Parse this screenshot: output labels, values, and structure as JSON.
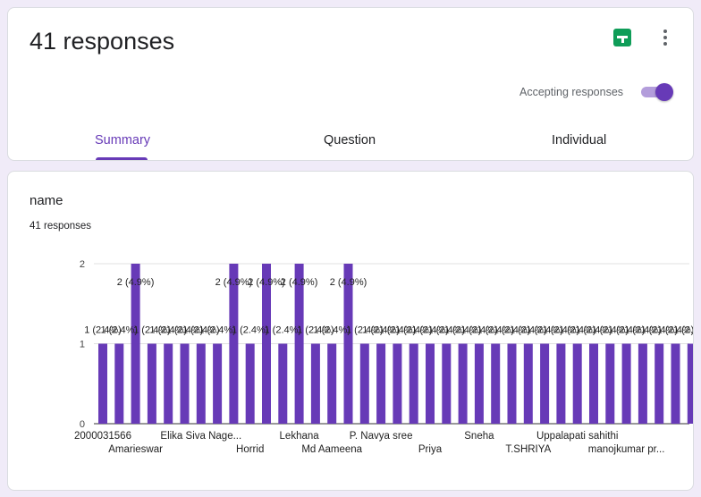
{
  "header": {
    "title": "41 responses",
    "accepting_label": "Accepting responses"
  },
  "icons": {
    "sheets": "google-sheets-icon",
    "more": "more-vert-icon"
  },
  "tabs": [
    {
      "label": "Summary",
      "active": true
    },
    {
      "label": "Question",
      "active": false
    },
    {
      "label": "Individual",
      "active": false
    }
  ],
  "question": {
    "title": "name",
    "response_count": "41 responses"
  },
  "colors": {
    "accent": "#673ab7",
    "bar": "#673ab7",
    "sheets": "#0f9d58"
  },
  "chart_data": {
    "type": "bar",
    "ylim": [
      0,
      2
    ],
    "y_ticks": [
      0,
      1,
      2
    ],
    "values": [
      1,
      1,
      2,
      1,
      1,
      1,
      1,
      1,
      2,
      1,
      2,
      1,
      2,
      1,
      1,
      2,
      1,
      1,
      1,
      1,
      1,
      1,
      1,
      1,
      1,
      1,
      1,
      1,
      1,
      1,
      1,
      1,
      1,
      1,
      1,
      1,
      1
    ],
    "bar_labels": [
      "1 (2.4%)",
      "1 (2.4%)",
      "2 (4.9%)",
      "1 (2.4%)",
      "1 (2.4%)",
      "1 (2.4%)",
      "1 (2.4%)",
      "1 (2.4%)",
      "2 (4.9%)",
      "1 (2.4%)",
      "2 (4.9%)",
      "1 (2.4%)",
      "2 (4.9%)",
      "1 (2.4%)",
      "1 (2.4%)",
      "2 (4.9%)",
      "1 (2.4%)",
      "1 (2.4%)",
      "1 (2.4%)",
      "1 (2.4%)",
      "1 (2.4%)",
      "1 (2.4%)",
      "1 (2.4%)",
      "1 (2.4%)",
      "1 (2.4%)",
      "1 (2.4%)",
      "1 (2.4%)",
      "1 (2.4%)",
      "1 (2.4%)",
      "1 (2.4%)",
      "1 (2.4%)",
      "1 (2.4%)",
      "1 (2.4%)",
      "1 (2.4%)",
      "1 (2.4%)",
      "1 (2.4%)",
      "1 (2.4%)"
    ],
    "visible_category_labels": [
      {
        "index": 0,
        "text": "2000031566"
      },
      {
        "index": 2,
        "text": "Amarieswar"
      },
      {
        "index": 6,
        "text": "Elika Siva Nage..."
      },
      {
        "index": 9,
        "text": "Horrid"
      },
      {
        "index": 12,
        "text": "Lekhana"
      },
      {
        "index": 14,
        "text": "Md Aameena"
      },
      {
        "index": 17,
        "text": "P. Navya sree"
      },
      {
        "index": 20,
        "text": "Priya"
      },
      {
        "index": 23,
        "text": "Sneha"
      },
      {
        "index": 26,
        "text": "T.SHRIYA"
      },
      {
        "index": 29,
        "text": "Uppalapati sahithi"
      },
      {
        "index": 32,
        "text": "manojkumar pr..."
      }
    ],
    "grid": true,
    "legend": "none"
  }
}
